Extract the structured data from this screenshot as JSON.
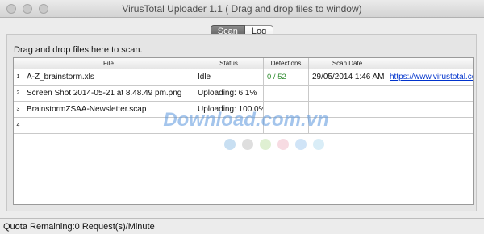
{
  "window": {
    "title": "VirusTotal Uploader 1.1 ( Drag and drop files to window)"
  },
  "tabs": [
    "Scan",
    "Log"
  ],
  "instruction": "Drag and drop files here to scan.",
  "table": {
    "headers": [
      "File",
      "Status",
      "Detections",
      "Scan Date"
    ],
    "rows": [
      {
        "n": "1",
        "file": "A-Z_brainstorm.xls",
        "status": "Idle",
        "detections": "0 / 52",
        "date": "29/05/2014 1:46 AM",
        "link": "https://www.virustotal.com"
      },
      {
        "n": "2",
        "file": "Screen Shot 2014-05-21 at 8.48.49 pm.png",
        "status": "Uploading: 6.1%",
        "detections": "",
        "date": "",
        "link": ""
      },
      {
        "n": "3",
        "file": "BrainstormZSAA-Newsletter.scap",
        "status": "Uploading: 100.0%",
        "detections": "",
        "date": "",
        "link": ""
      },
      {
        "n": "4",
        "file": "",
        "status": "",
        "detections": "",
        "date": "",
        "link": ""
      }
    ]
  },
  "status_bar": {
    "quota": "Quota Remaining:0 Request(s)/Minute"
  },
  "watermark": {
    "text": "Download.com.vn",
    "dot_colors": [
      "#c8dff2",
      "#dedede",
      "#dff0d2",
      "#f7dbe2",
      "#d0e4f7",
      "#d9edf7"
    ]
  },
  "colors": {
    "detections_clean": "#2e8b2e",
    "link": "#0033cc",
    "tab_active": "#6a6a6a"
  }
}
